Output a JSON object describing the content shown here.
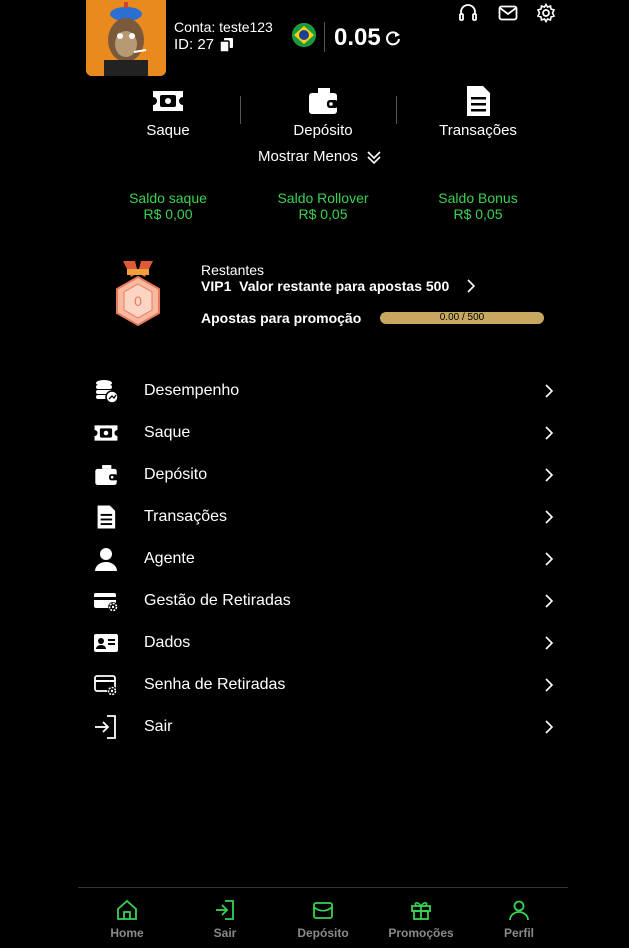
{
  "header": {
    "account_label": "Conta: teste123",
    "id_label": "ID: 27",
    "balance": "0.05",
    "flag_name": "brazil-flag"
  },
  "quick_actions": [
    {
      "label": "Saque",
      "icon": "ticket-icon"
    },
    {
      "label": "Depósito",
      "icon": "wallet-icon"
    },
    {
      "label": "Transações",
      "icon": "document-icon"
    }
  ],
  "show_less": "Mostrar Menos",
  "balances": [
    {
      "title": "Saldo saque",
      "value": "R$ 0,00"
    },
    {
      "title": "Saldo Rollover",
      "value": "R$ 0,05"
    },
    {
      "title": "Saldo Bonus",
      "value": "R$ 0,05"
    }
  ],
  "vip": {
    "badge_level": "0",
    "remaining_label": "Restantes",
    "level": "VIP1",
    "remaining_text": "Valor restante para apostas 500",
    "promo_label": "Apostas para promoção",
    "progress_text": "0.00 / 500",
    "progress_fraction": 0
  },
  "menu": [
    {
      "label": "Desempenho",
      "icon": "coins-chart-icon"
    },
    {
      "label": "Saque",
      "icon": "ticket-icon"
    },
    {
      "label": "Depósito",
      "icon": "wallet-icon"
    },
    {
      "label": "Transações",
      "icon": "document-icon"
    },
    {
      "label": "Agente",
      "icon": "user-icon"
    },
    {
      "label": "Gestão de Retiradas",
      "icon": "card-gear-icon"
    },
    {
      "label": "Dados",
      "icon": "id-card-icon"
    },
    {
      "label": "Senha de Retiradas",
      "icon": "card-settings-icon"
    },
    {
      "label": "Sair",
      "icon": "logout-icon"
    }
  ],
  "bottom_nav": [
    {
      "label": "Home",
      "icon": "home-icon"
    },
    {
      "label": "Sair",
      "icon": "logout-icon"
    },
    {
      "label": "Depósito",
      "icon": "wallet-icon"
    },
    {
      "label": "Promoções",
      "icon": "gift-icon"
    },
    {
      "label": "Perfil",
      "icon": "user-icon"
    }
  ],
  "colors": {
    "accent_green": "#39d353",
    "progress_bar": "#c8a860",
    "avatar_bg": "#e88a1d"
  }
}
